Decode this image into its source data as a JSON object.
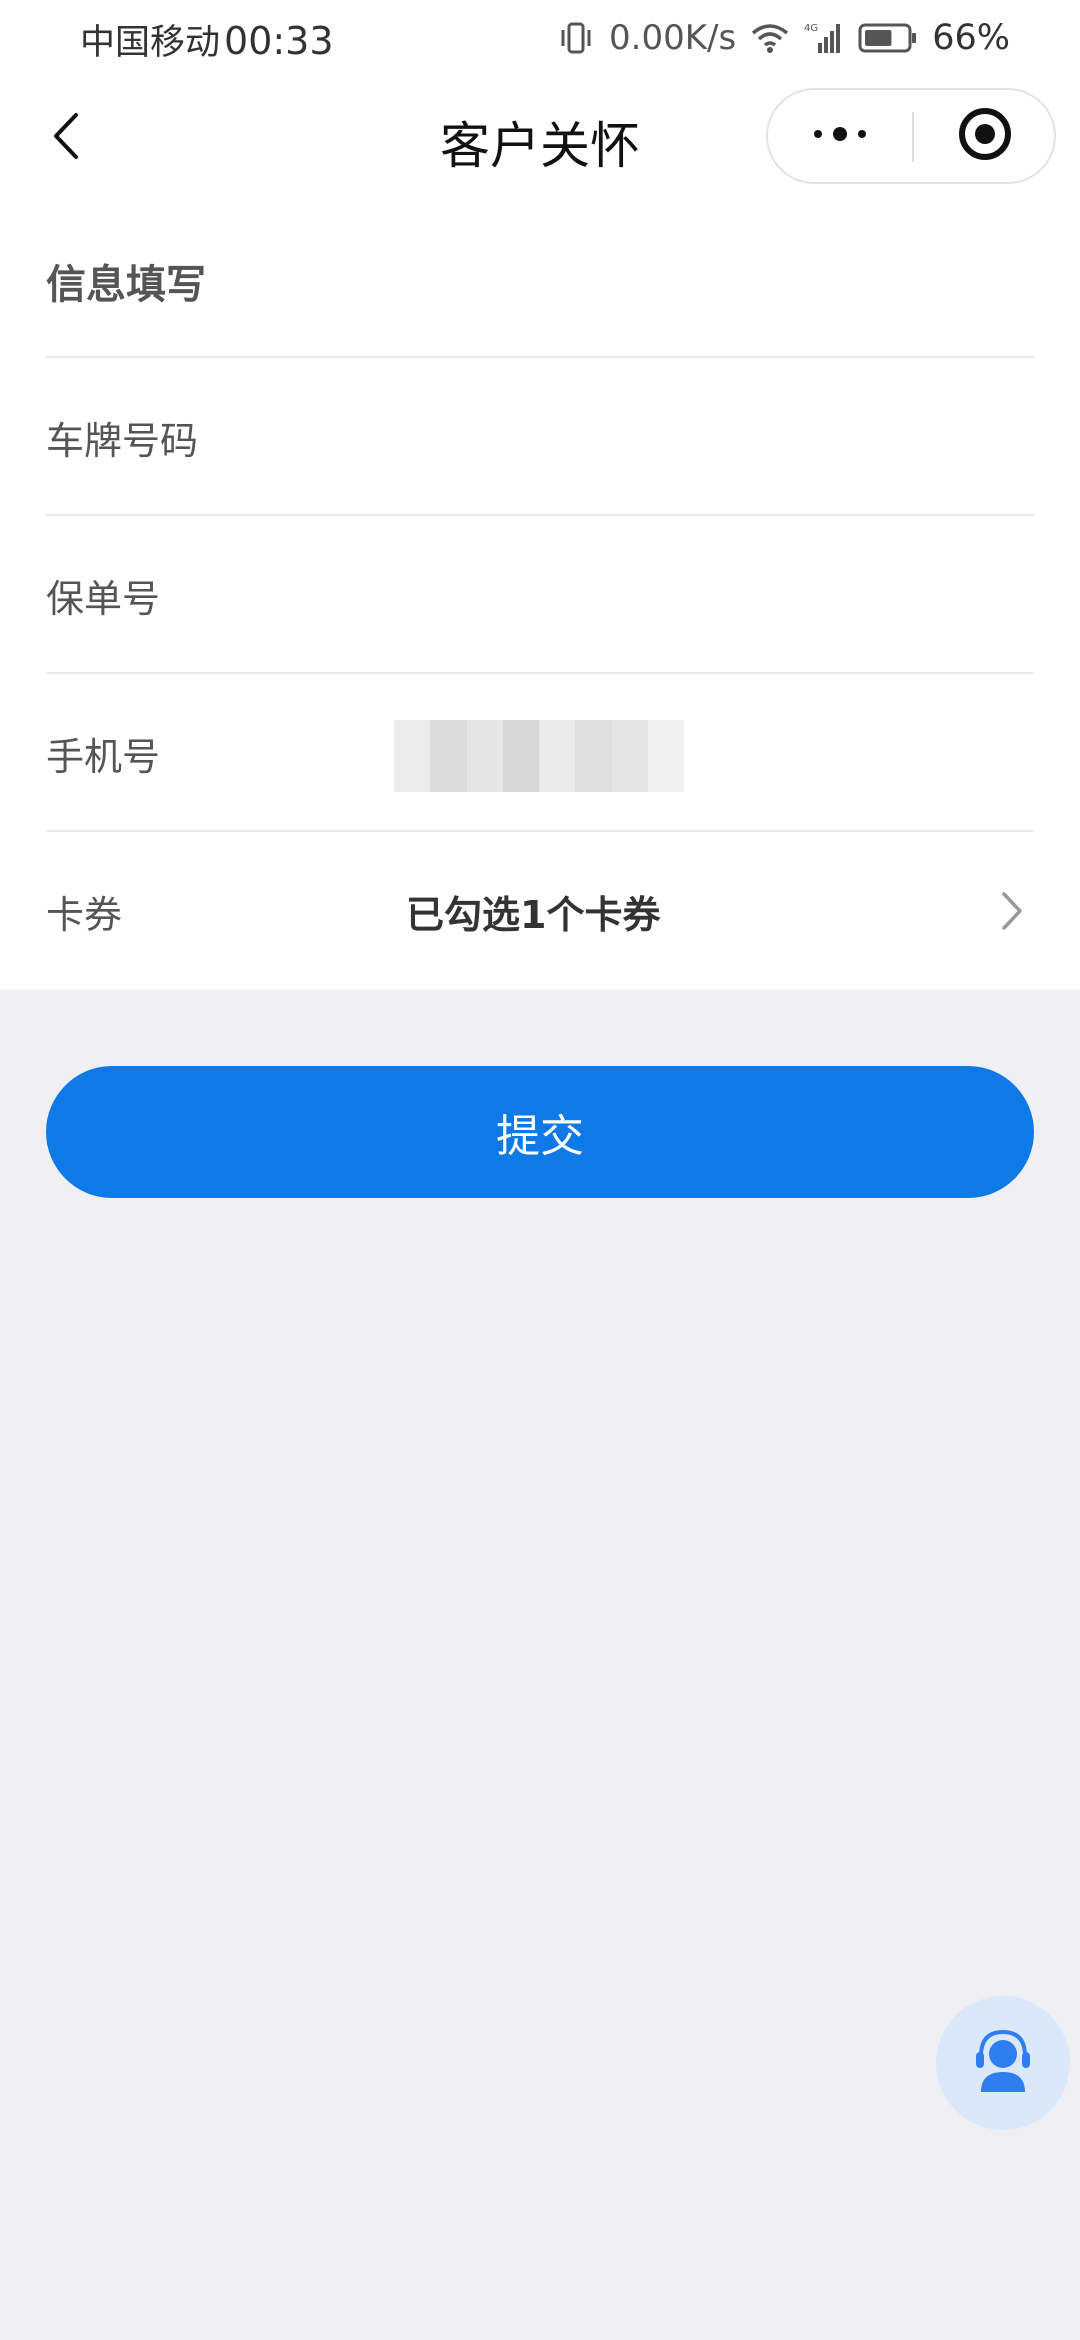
{
  "status_bar": {
    "carrier": "中国移动",
    "time": "00:33",
    "net_speed": "0.00K/s",
    "network_type": "4G",
    "battery_percent": "66%",
    "battery_level": 0.66
  },
  "navbar": {
    "title": "客户关怀",
    "back_icon": "chevron-left-icon",
    "more_icon": "more-dots-icon",
    "close_icon": "target-close-icon"
  },
  "form": {
    "section_title": "信息填写",
    "fields": [
      {
        "label": "车牌号码",
        "value": "",
        "placeholder": ""
      },
      {
        "label": "保单号",
        "value": "",
        "placeholder": ""
      },
      {
        "label": "手机号",
        "value": "",
        "placeholder": ""
      }
    ],
    "coupon": {
      "label": "卡券",
      "value": "已勾选1个卡券"
    }
  },
  "submit": {
    "label": "提交"
  },
  "colors": {
    "accent": "#0f79e7",
    "page_bg": "#efeff4",
    "cs_bg": "#dbe8fb",
    "cs_icon": "#2f7ef0"
  },
  "icons": {
    "customer_service": "customer-service-icon",
    "coupon_chevron": "chevron-right-icon"
  }
}
